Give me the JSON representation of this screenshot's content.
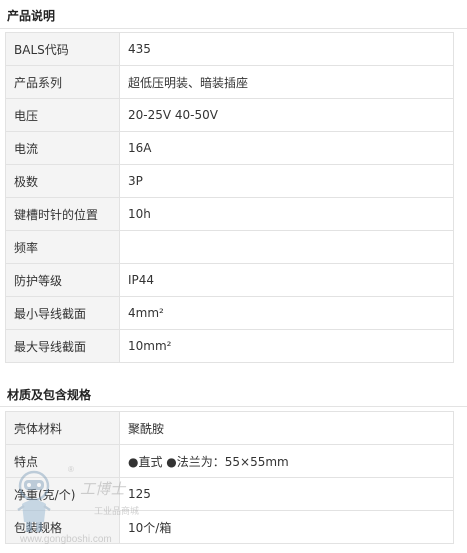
{
  "section1": {
    "title": "产品说明",
    "rows": [
      {
        "k": "BALS代码",
        "v": "435"
      },
      {
        "k": "产品系列",
        "v": "超低压明装、暗装插座"
      },
      {
        "k": "电压",
        "v": "20-25V 40-50V"
      },
      {
        "k": "电流",
        "v": "16A"
      },
      {
        "k": "极数",
        "v": "3P"
      },
      {
        "k": "键槽时针的位置",
        "v": "10h"
      },
      {
        "k": "频率",
        "v": ""
      },
      {
        "k": "防护等级",
        "v": "IP44"
      },
      {
        "k": "最小导线截面",
        "v": "4mm²"
      },
      {
        "k": "最大导线截面",
        "v": "10mm²"
      }
    ]
  },
  "section2": {
    "title": "材质及包含规格",
    "rows": [
      {
        "k": "壳体材料",
        "v": "聚酰胺"
      },
      {
        "k": "特点",
        "v": "●直式 ●法兰为：55×55mm"
      },
      {
        "k": "净重(克/个)",
        "v": "125"
      },
      {
        "k": "包装规格",
        "v": "10个/箱"
      }
    ]
  },
  "watermark": {
    "brand": "工博士",
    "tagline": "工业品商城",
    "url": "www.gongboshi.com",
    "mark": "®"
  }
}
